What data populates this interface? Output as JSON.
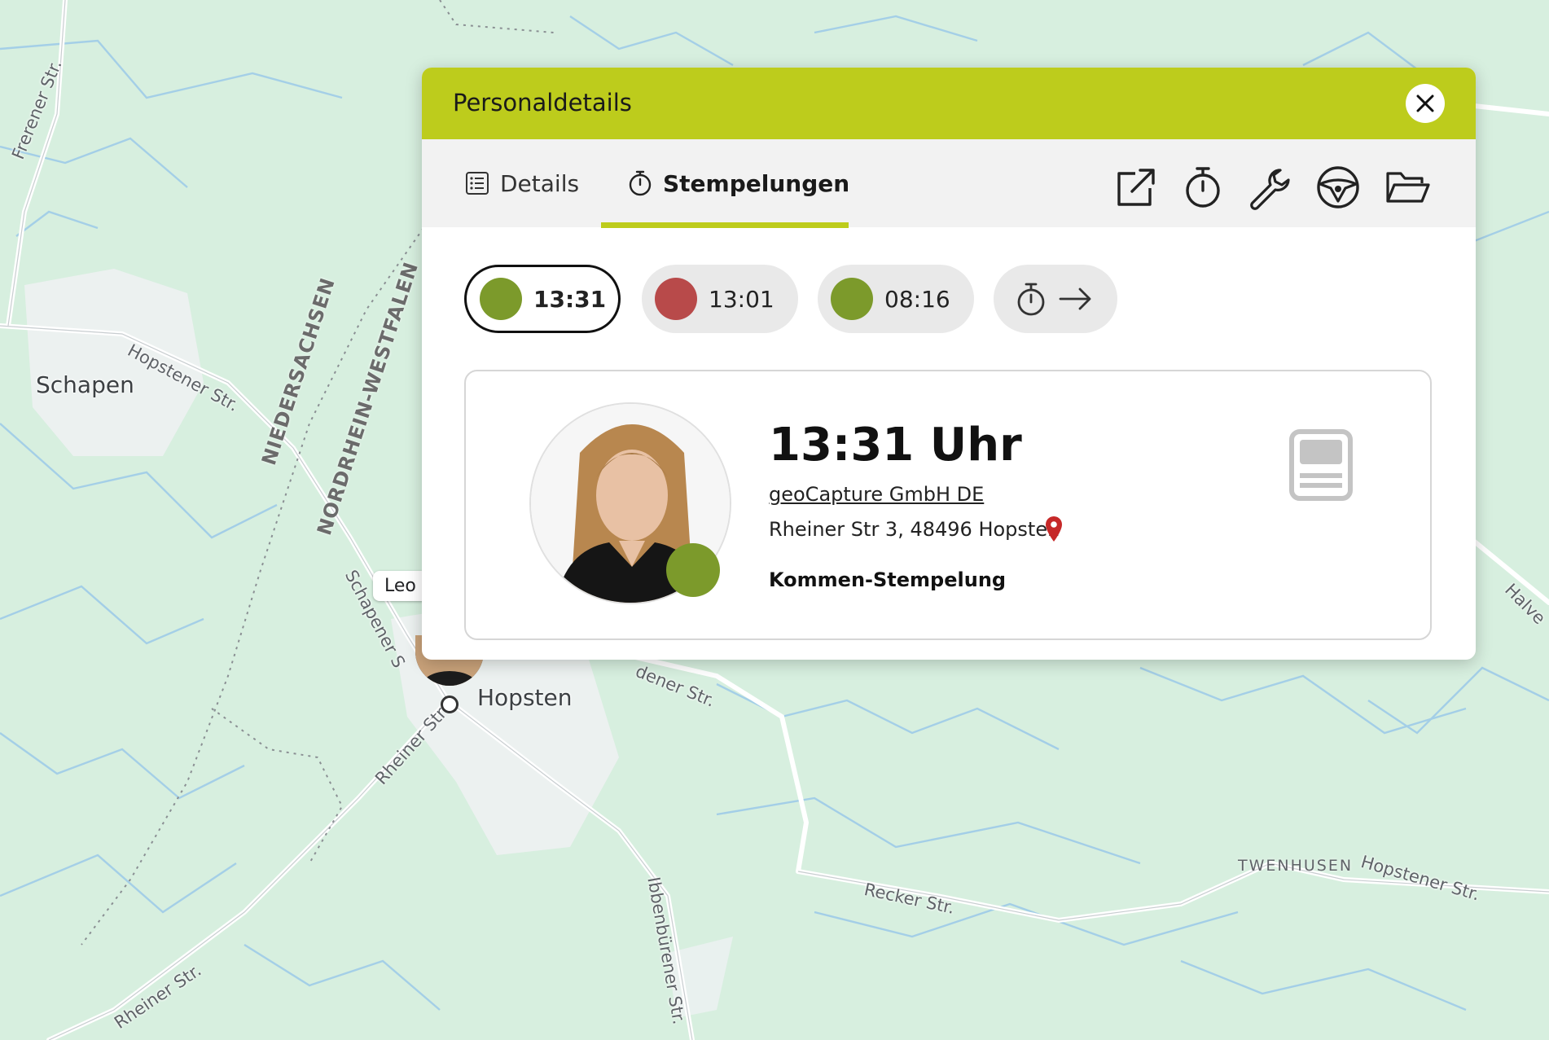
{
  "map": {
    "towns": {
      "schapen": "Schapen",
      "hopsten": "Hopsten"
    },
    "streets": {
      "frerener": "Frerener Str.",
      "hopstener_1": "Hopstener Str.",
      "schapener": "Schapener S",
      "dener": "dener Str.",
      "rheiner_1": "Rheiner Str",
      "rheiner_2": "Rheiner Str.",
      "ibbenbuerener": "Ibbenbürener Str.",
      "recker": "Recker Str.",
      "hopstener_2": "Hopstener Str.",
      "halve": "Halve"
    },
    "borders": {
      "niedersachsen": "NIEDERSACHSEN",
      "nrw": "NORDRHEIN-WESTFALEN"
    },
    "localities": {
      "twenhusen": "TWENHUSEN"
    },
    "marker_tag": "Leo"
  },
  "panel": {
    "title": "Personaldetails",
    "close_icon": "close-icon",
    "tabs": [
      {
        "label": "Details",
        "icon": "list-icon",
        "active": false
      },
      {
        "label": "Stempelungen",
        "icon": "stopwatch-icon",
        "active": true
      }
    ],
    "toolbar_icons": [
      "external-link-icon",
      "stopwatch-icon",
      "wrench-icon",
      "steering-wheel-icon",
      "folder-open-icon"
    ],
    "accent_color": "#bdcc1c"
  },
  "stamps": [
    {
      "time": "13:31",
      "status_color": "#7c9a2b",
      "selected": true
    },
    {
      "time": "13:01",
      "status_color": "#b84a4a",
      "selected": false
    },
    {
      "time": "08:16",
      "status_color": "#7c9a2b",
      "selected": false
    }
  ],
  "stamp_more_icons": [
    "stopwatch-icon",
    "arrow-right-icon"
  ],
  "detail_card": {
    "time": "13:31 Uhr",
    "company": "geoCapture GmbH DE",
    "address": "Rheiner Str 3, 48496 Hopsten",
    "type": "Kommen-Stempelung",
    "status_color": "#7c9a2b",
    "pin_color": "#c62828",
    "device_icon": "terminal-icon"
  }
}
